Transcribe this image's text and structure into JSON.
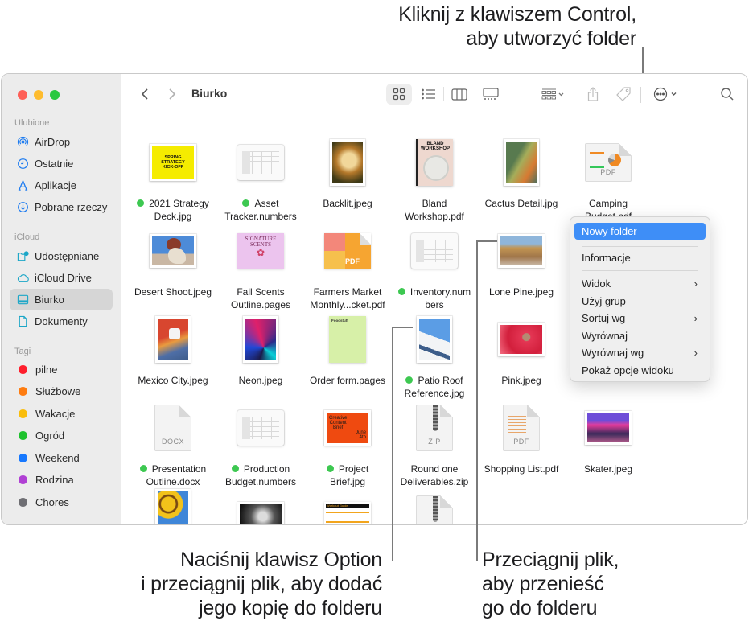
{
  "callouts": {
    "top": [
      "Kliknij z klawiszem Control,",
      "aby utworzyć folder"
    ],
    "bottom_left": [
      "Naciśnij klawisz Option",
      "i przeciągnij plik, aby dodać",
      "jego kopię do folderu"
    ],
    "bottom_right": [
      "Przeciągnij plik,",
      "aby przenieść",
      "go do folderu"
    ]
  },
  "window": {
    "title": "Biurko",
    "toolbar": {
      "back": "chevron-left-icon",
      "forward": "chevron-right-icon",
      "views": [
        "icon-view",
        "list-view",
        "column-view",
        "gallery-view"
      ],
      "selected_view": "icon-view",
      "group": "group-icon",
      "share": "share-icon",
      "tag": "tag-icon",
      "more": "ellipsis-circle-icon",
      "search": "search-icon"
    }
  },
  "sidebar": {
    "favorites_header": "Ulubione",
    "favorites": [
      {
        "label": "AirDrop",
        "icon": "airdrop-icon"
      },
      {
        "label": "Ostatnie",
        "icon": "clock-icon"
      },
      {
        "label": "Aplikacje",
        "icon": "applications-icon"
      },
      {
        "label": "Pobrane rzeczy",
        "icon": "download-icon"
      }
    ],
    "icloud_header": "iCloud",
    "icloud": [
      {
        "label": "Udostępniane",
        "icon": "shared-folder-icon"
      },
      {
        "label": "iCloud Drive",
        "icon": "cloud-icon"
      },
      {
        "label": "Biurko",
        "icon": "desktop-icon",
        "selected": true
      },
      {
        "label": "Dokumenty",
        "icon": "document-icon"
      }
    ],
    "tags_header": "Tagi",
    "tags": [
      {
        "label": "pilne",
        "color": "#fe1e2c"
      },
      {
        "label": "Służbowe",
        "color": "#fe7c10"
      },
      {
        "label": "Wakacje",
        "color": "#f9bd0b"
      },
      {
        "label": "Ogród",
        "color": "#1ec22e"
      },
      {
        "label": "Weekend",
        "color": "#1778fe"
      },
      {
        "label": "Rodzina",
        "color": "#b040d4"
      },
      {
        "label": "Chores",
        "color": "#6e6e73"
      }
    ]
  },
  "files": [
    {
      "name1": "2021 Strategy",
      "name2": "Deck.jpg",
      "tag": true
    },
    {
      "name1": "Asset",
      "name2": "Tracker.numbers",
      "tag": true
    },
    {
      "name1": "Backlit.jpeg",
      "name2": "",
      "tag": false
    },
    {
      "name1": "Bland",
      "name2": "Workshop.pdf",
      "tag": false
    },
    {
      "name1": "Cactus Detail.jpg",
      "name2": "",
      "tag": false
    },
    {
      "name1": "Camping",
      "name2": "Budget.pdf",
      "tag": false
    },
    {
      "name1": "Desert Shoot.jpeg",
      "name2": "",
      "tag": false
    },
    {
      "name1": "Fall Scents",
      "name2": "Outline.pages",
      "tag": false
    },
    {
      "name1": "Farmers Market",
      "name2": "Monthly...cket.pdf",
      "tag": false
    },
    {
      "name1": "Inventory.num",
      "name2": "bers",
      "tag": true
    },
    {
      "name1": "Lone Pine.jpeg",
      "name2": "",
      "tag": false
    },
    {
      "name1": "Mexico City.jpeg",
      "name2": "",
      "tag": false
    },
    {
      "name1": "Neon.jpeg",
      "name2": "",
      "tag": false
    },
    {
      "name1": "Order form.pages",
      "name2": "",
      "tag": false
    },
    {
      "name1": "Patio Roof",
      "name2": "Reference.jpg",
      "tag": true
    },
    {
      "name1": "Pink.jpeg",
      "name2": "",
      "tag": false
    },
    {
      "name1": "Presentation",
      "name2": "Outline.docx",
      "tag": true
    },
    {
      "name1": "Production",
      "name2": "Budget.numbers",
      "tag": true
    },
    {
      "name1": "Project",
      "name2": "Brief.jpg",
      "tag": true
    },
    {
      "name1": "Round one",
      "name2": "Deliverables.zip",
      "tag": false
    },
    {
      "name1": "Shopping List.pdf",
      "name2": "",
      "tag": false
    },
    {
      "name1": "Skater.jpeg",
      "name2": "",
      "tag": false
    }
  ],
  "thumb_text": {
    "strategy": [
      "SPRING",
      "STRATEGY",
      "KICK-OFF"
    ],
    "bland": [
      "BLAND",
      "WORKSHOP"
    ],
    "signature": [
      "SIGNATURE",
      "SCENTS"
    ],
    "creative": [
      "Creative",
      "Content",
      "Brief",
      "June",
      "4th"
    ],
    "pdf": "PDF",
    "docx": "DOCX",
    "zip": "ZIP",
    "workout": "Workout Guide",
    "order": "Foodstuff"
  },
  "context_menu": {
    "items": [
      {
        "label": "Nowy folder",
        "highlighted": true
      },
      {
        "label": "Informacje"
      },
      {
        "label": "Widok",
        "submenu": true
      },
      {
        "label": "Użyj grup"
      },
      {
        "label": "Sortuj wg",
        "submenu": true
      },
      {
        "label": "Wyrównaj"
      },
      {
        "label": "Wyrównaj wg",
        "submenu": true
      },
      {
        "label": "Pokaż opcje widoku"
      }
    ],
    "chevron": "›"
  }
}
